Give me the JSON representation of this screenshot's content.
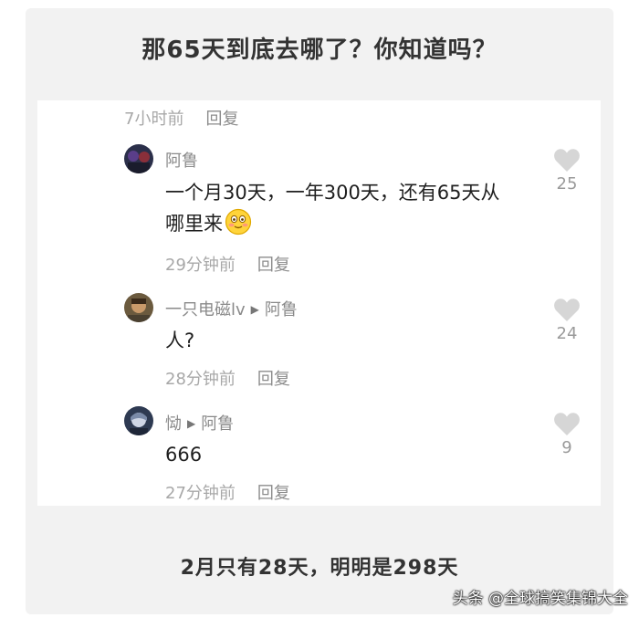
{
  "title": "那65天到底去哪了？你知道吗？",
  "reply_label": "回复",
  "top_meta": {
    "time": "7小时前"
  },
  "comments": [
    {
      "user": "阿鲁",
      "reply_to": "",
      "text_line1": "一个月30天，一年300天，还有65天从",
      "text_line2": "哪里来",
      "time": "29分钟前",
      "likes": "25"
    },
    {
      "user": "一只电磁lv",
      "reply_to": "阿鲁",
      "text": "人?",
      "time": "28分钟前",
      "likes": "24"
    },
    {
      "user": "恸",
      "reply_to": "阿鲁",
      "text": "666",
      "time": "27分钟前",
      "likes": "9"
    }
  ],
  "footer": "2月只有28天，明明是298天",
  "watermark": "头条 @全球搞笑集锦大全",
  "icons": {
    "like": "heart-icon",
    "reply_arrow": "play-arrow-icon",
    "emoji": "blushing-smile-emoji"
  },
  "colors": {
    "background": "#f2f2f2",
    "panel": "#ffffff",
    "heart": "#d6d6d6",
    "muted_text": "#a8a8a8"
  }
}
